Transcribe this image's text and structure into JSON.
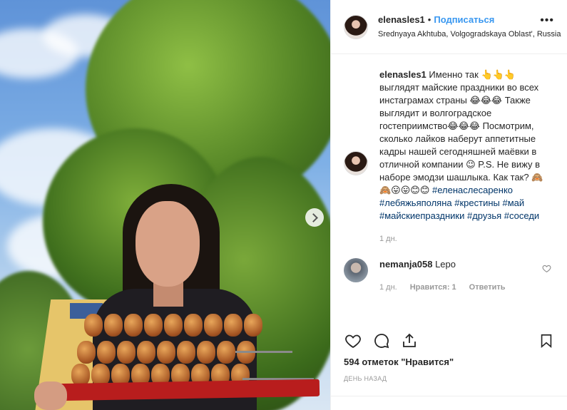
{
  "post": {
    "username": "elenasles1",
    "follow_label": "Подписаться",
    "location": "Srednyaya Akhtuba, Volgogradskaya Oblast', Russia"
  },
  "caption": {
    "username": "elenasles1",
    "text": "Именно так 👆👆👆 выглядят майские праздники во всех инстаграмах страны 😂😂😂 Также выглядит и волгоградское гостеприимство😂😂😂 Посмотрим, сколько лайков наберут аппетитные кадры нашей сегодняшней маёвки в отличной компании 😉 P.S. Не вижу в наборе эмодзи шашлыка. Как так? 🙈🙈😛😛😊😊",
    "hashtags": [
      "#еленаслесаренко",
      "#лебяжьяполяна",
      "#крестины",
      "#май",
      "#майскиепраздники",
      "#друзья",
      "#соседи"
    ],
    "time": "1 дн."
  },
  "comment": {
    "username": "nemanja058",
    "text": "Lepo",
    "time": "1 дн.",
    "likes_label": "Нравится: 1",
    "reply_label": "Ответить"
  },
  "likes": {
    "count": "594",
    "label": "отметок \"Нравится\""
  },
  "date_label": "ДЕНЬ НАЗАД",
  "icons": [
    "heart-icon",
    "comment-icon",
    "share-icon",
    "bookmark-icon",
    "more-icon",
    "next-arrow-icon"
  ],
  "colors": {
    "link": "#3897f0",
    "hashtag": "#003569",
    "muted": "#999999"
  }
}
